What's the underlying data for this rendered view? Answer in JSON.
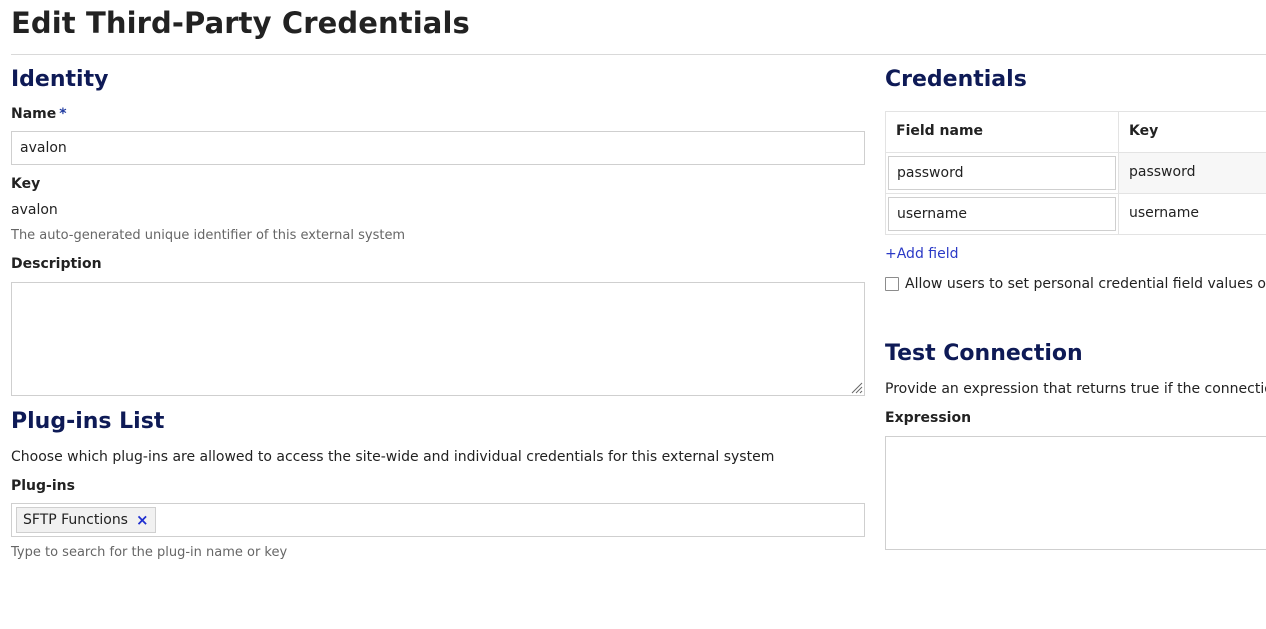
{
  "page": {
    "title": "Edit Third-Party Credentials"
  },
  "identity": {
    "heading": "Identity",
    "name": {
      "label": "Name",
      "required_marker": "*",
      "value": "avalon"
    },
    "key": {
      "label": "Key",
      "value": "avalon",
      "hint": "The auto-generated unique identifier of this external system"
    },
    "description": {
      "label": "Description",
      "value": ""
    }
  },
  "plugins": {
    "heading": "Plug-ins List",
    "instructions": "Choose which plug-ins are allowed to access the site-wide and individual credentials for this external system",
    "field_label": "Plug-ins",
    "selected": [
      {
        "label": "SFTP Functions",
        "remove_symbol": "×"
      }
    ],
    "hint": "Type to search for the plug-in name or key"
  },
  "credentials": {
    "heading": "Credentials",
    "columns": [
      "Field name",
      "Key"
    ],
    "rows": [
      {
        "field_name": "password",
        "key": "password"
      },
      {
        "field_name": "username",
        "key": "username"
      }
    ],
    "add_field_label": "+Add field",
    "allow_personal_label": "Allow users to set personal credential field values on the"
  },
  "test_connection": {
    "heading": "Test Connection",
    "instructions": "Provide an expression that returns true if the connection w",
    "expression_label": "Expression",
    "expression_value": ""
  },
  "colors": {
    "heading": "#0e1a56",
    "link": "#2a39c6",
    "border": "#cfcfcf"
  }
}
